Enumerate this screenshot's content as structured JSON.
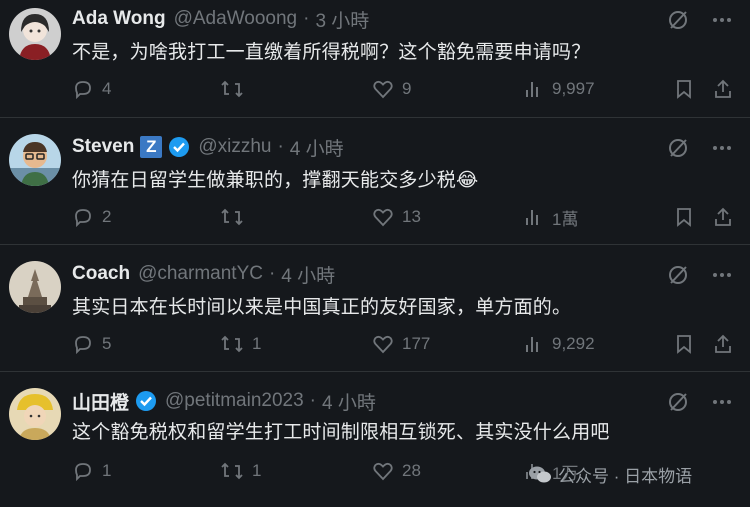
{
  "tweets": [
    {
      "display_name": "Ada Wong",
      "handle": "@AdaWooong",
      "time": "3 小時",
      "text": "不是，为啥我打工一直缴着所得税啊？这个豁免需要申请吗？",
      "replies": "4",
      "retweets": "",
      "likes": "9",
      "views": "9,997",
      "verified": false,
      "avatar_icon": "woman-avatar"
    },
    {
      "display_name": "Steven",
      "handle": "@xizzhu",
      "time": "4 小時",
      "text": "你猜在日留学生做兼职的，撑翻天能交多少税😂",
      "badge_letter": "Z",
      "replies": "2",
      "retweets": "",
      "likes": "13",
      "views": "1萬",
      "verified": true,
      "avatar_icon": "glasses-man-avatar"
    },
    {
      "display_name": "Coach",
      "handle": "@charmantYC",
      "time": "4 小時",
      "text": "其实日本在长时间以来是中国真正的友好国家，单方面的。",
      "replies": "5",
      "retweets": "1",
      "likes": "177",
      "views": "9,292",
      "verified": false,
      "avatar_icon": "statue-avatar"
    },
    {
      "display_name": "山田橙",
      "handle": "@petitmain2023",
      "time": "4 小時",
      "text": "这个豁免税权和留学生打工时间制限相互锁死、其实没什么用吧",
      "replies": "1",
      "retweets": "1",
      "likes": "28",
      "views": "1万",
      "verified": true,
      "avatar_icon": "yellow-hat-avatar"
    }
  ],
  "separator": "·",
  "watermark": {
    "text": "公众号 · 日本物语",
    "icon": "wechat-icon"
  },
  "colors": {
    "background": "#15181c",
    "text": "#e7e9ea",
    "muted": "#71767b",
    "border": "#2f3336",
    "verified": "#1d9bf0",
    "badge": "#3b79c4"
  }
}
